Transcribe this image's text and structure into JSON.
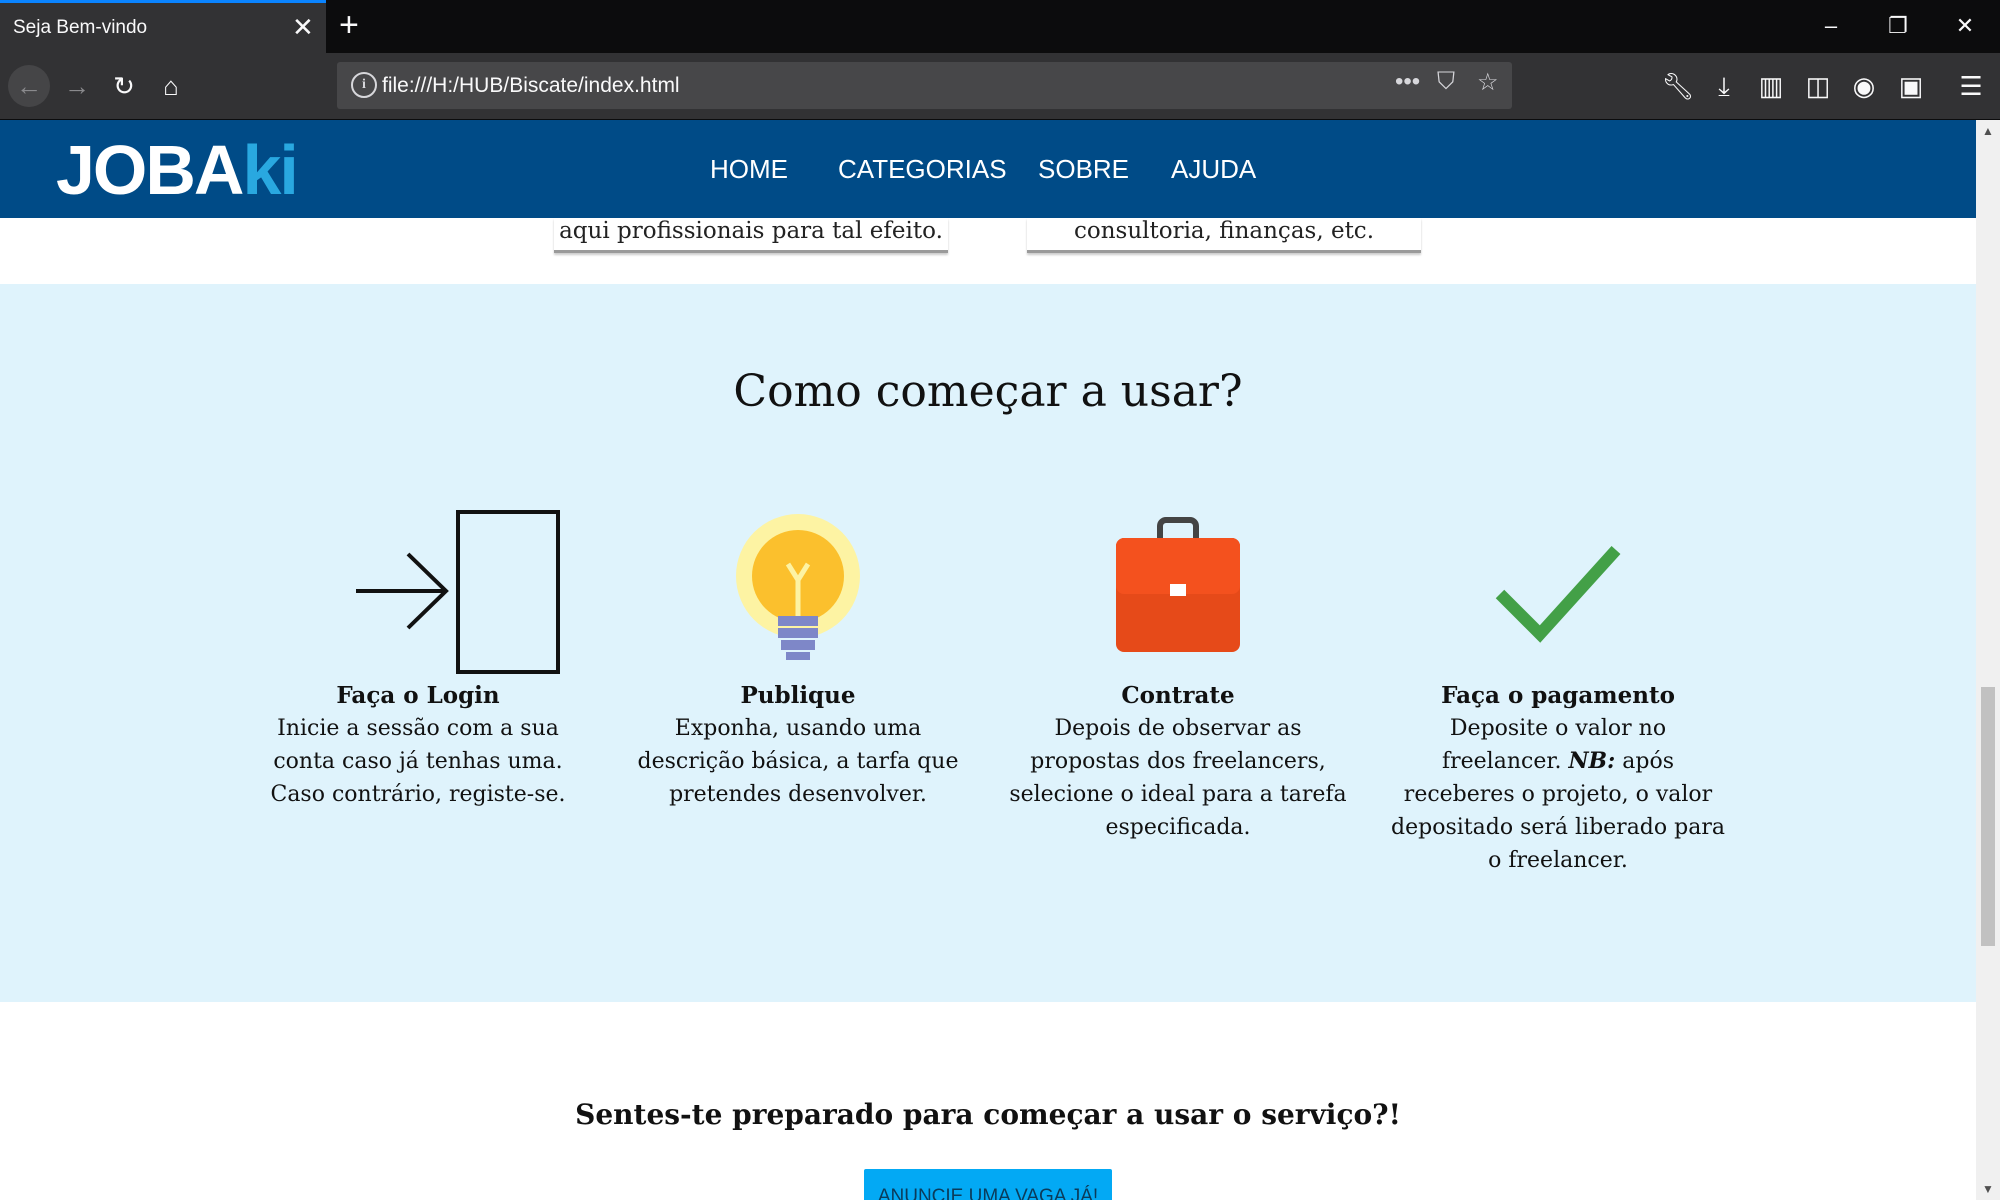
{
  "browser": {
    "tab_title": "Seja Bem-vindo",
    "url": "file:///H:/HUB/Biscate/index.html"
  },
  "site": {
    "logo": {
      "part1": "JOBA",
      "part2": "ki"
    },
    "nav": [
      "HOME",
      "CATEGORIAS",
      "SOBRE",
      "AJUDA"
    ],
    "prev_cards": [
      "aqui profissionais para tal efeito.",
      "consultoria, finanças, etc."
    ],
    "how": {
      "title": "Como começar a usar?",
      "steps": [
        {
          "title": "Faça o Login",
          "text": "Inicie a sessão com a sua conta caso já tenhas uma. Caso contrário, registe-se.",
          "icon": "login-icon"
        },
        {
          "title": "Publique",
          "text": "Exponha, usando uma descrição básica, a tarfa que pretendes desenvolver.",
          "icon": "lightbulb-icon"
        },
        {
          "title": "Contrate",
          "text": "Depois de observar as propostas dos freelancers, selecione o ideal para a tarefa especificada.",
          "icon": "briefcase-icon"
        },
        {
          "title": "Faça o pagamento",
          "text_before": "Deposite o valor no freelancer.",
          "text_em": "NB:",
          "text_after": "após receberes o projeto, o valor depositado será liberado para o freelancer.",
          "icon": "checkmark-icon"
        }
      ]
    },
    "cta": {
      "title": "Sentes-te preparado para começar a usar o serviço?!",
      "button": "ANUNCIE UMA VAGA JÁ!"
    }
  },
  "colors": {
    "header": "#004b87",
    "accent": "#29a8e0",
    "section_bg": "#dff3fc",
    "button": "#03a9f4"
  }
}
